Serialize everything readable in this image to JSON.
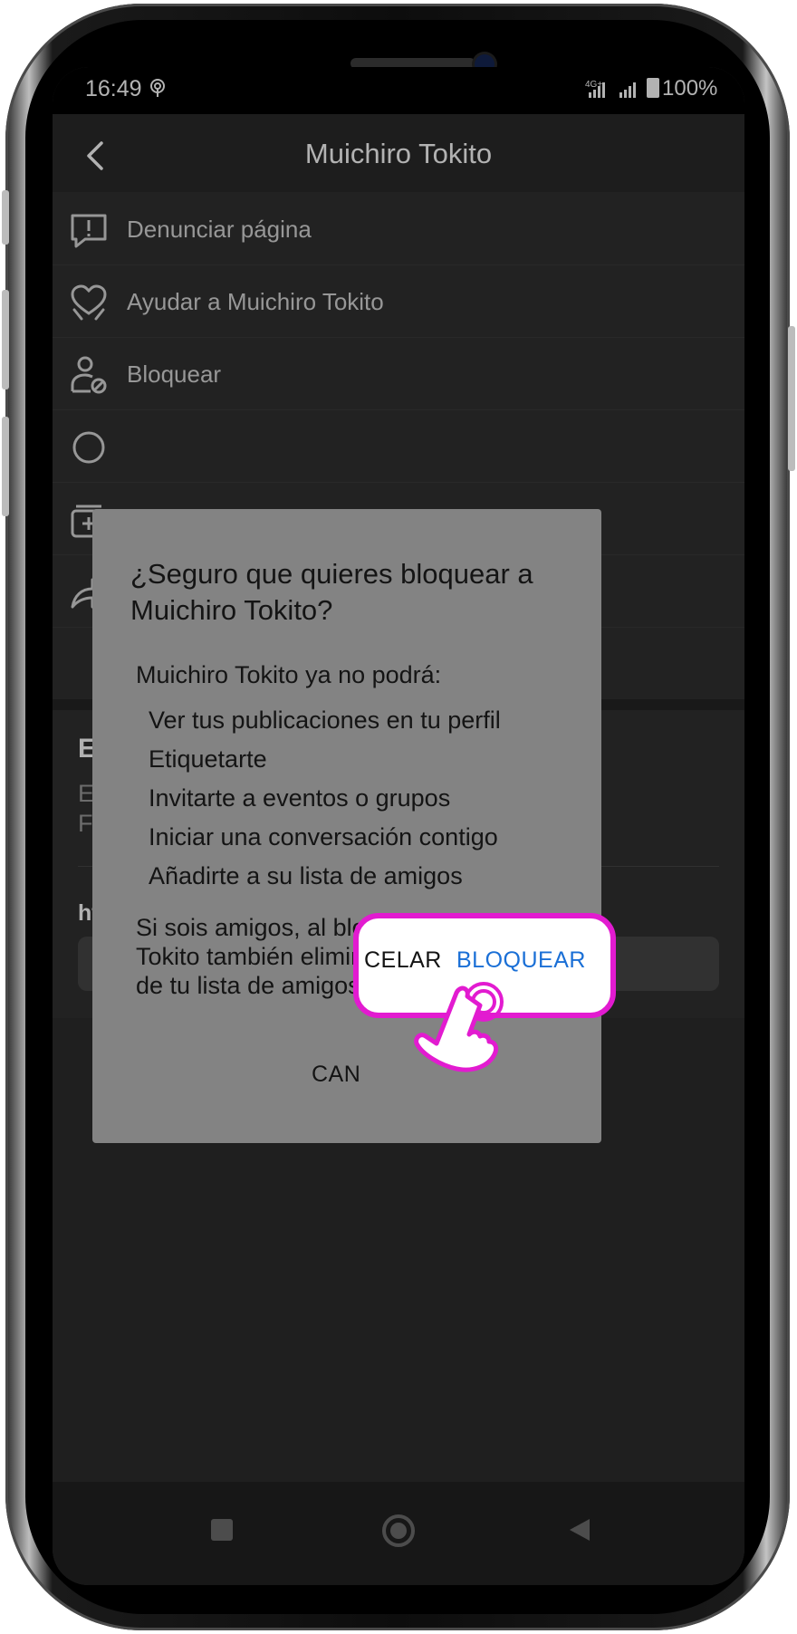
{
  "status_bar": {
    "time": "16:49",
    "battery": "100%",
    "network_icon": "hotspot-icon",
    "signal_icons": "4g-signal-icon"
  },
  "header": {
    "title": "Muichiro Tokito",
    "back_icon": "chevron-left-icon"
  },
  "menu": {
    "items": [
      {
        "label": "Denunciar página",
        "icon": "report-icon"
      },
      {
        "label": "Ayudar a Muichiro Tokito",
        "icon": "heart-hands-icon"
      },
      {
        "label": "Bloquear",
        "icon": "block-user-icon"
      },
      {
        "label": "",
        "icon": "circle-icon"
      },
      {
        "label": "",
        "icon": "add-collection-icon"
      },
      {
        "label": "",
        "icon": "share-icon"
      }
    ]
  },
  "info_card": {
    "title_partial": "E",
    "text_partial": "E\nFa",
    "link_partial": "ht"
  },
  "dialog": {
    "title": "¿Seguro que quieres bloquear a Muichiro Tokito?",
    "subhead": "Muichiro Tokito ya no podrá:",
    "list": [
      "Ver tus publicaciones en tu perfil",
      "Etiquetarte",
      "Invitarte a eventos o grupos",
      "Iniciar una conversación contigo",
      "Añadirte a su lista de amigos"
    ],
    "note": "Si sois amigos, al bloquear a Muichiro Tokito también eliminarás a esta persona de tu lista de amigos.",
    "cancel_label": "CANCELAR",
    "cancel_label_partial": "CAN",
    "cancel_label_tail": "CELAR",
    "block_label": "BLOQUEAR"
  },
  "colors": {
    "accent": "#1a6fd6",
    "highlight": "#e21bd0"
  }
}
